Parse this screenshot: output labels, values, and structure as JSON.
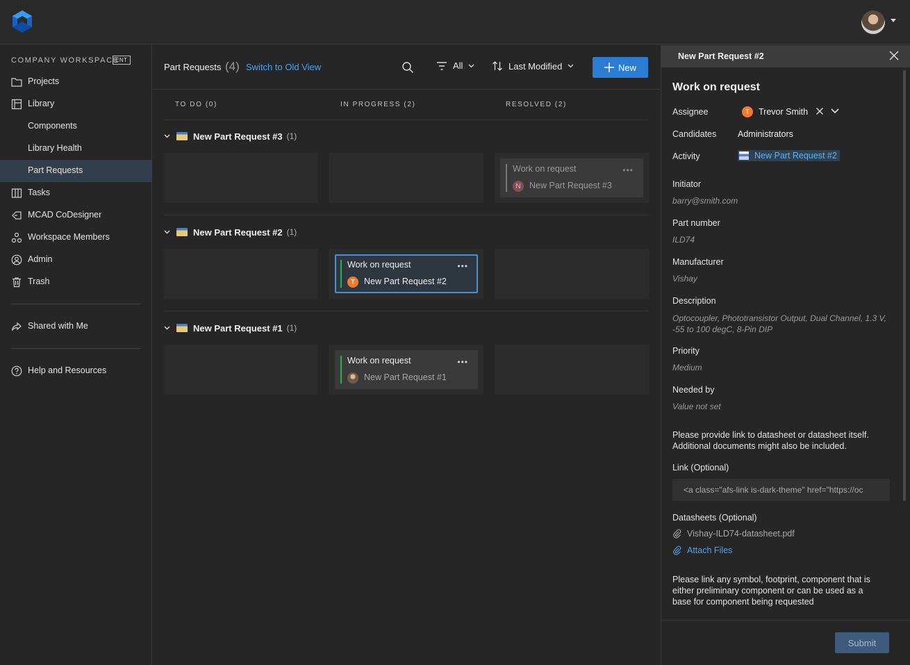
{
  "sidebar": {
    "workspace_label": "COMPANY WORKSPACE",
    "workspace_badge": "ENT",
    "items": [
      {
        "label": "Projects"
      },
      {
        "label": "Library"
      },
      {
        "label": "Components"
      },
      {
        "label": "Library Health"
      },
      {
        "label": "Part Requests"
      },
      {
        "label": "Tasks"
      },
      {
        "label": "MCAD CoDesigner"
      },
      {
        "label": "Workspace Members"
      },
      {
        "label": "Admin"
      },
      {
        "label": "Trash"
      },
      {
        "label": "Shared with Me"
      },
      {
        "label": "Help and Resources"
      }
    ]
  },
  "toolbar": {
    "title": "Part Requests",
    "count": "(4)",
    "switch_link": "Switch to Old View",
    "filter_label": "All",
    "sort_label": "Last Modified",
    "new_label": "New"
  },
  "board": {
    "columns": [
      "TO DO  (0)",
      "IN PROGRESS  (2)",
      "RESOLVED  (2)"
    ],
    "groups": [
      {
        "title": "New Part Request #3",
        "count": "(1)",
        "card": {
          "title": "Work on request",
          "sub": "New Part Request #3",
          "avatar": "N"
        }
      },
      {
        "title": "New Part Request #2",
        "count": "(1)",
        "card": {
          "title": "Work on request",
          "sub": "New Part Request #2",
          "avatar": "T"
        }
      },
      {
        "title": "New Part Request #1",
        "count": "(1)",
        "card": {
          "title": "Work on request",
          "sub": "New Part Request #1",
          "avatar": ""
        }
      }
    ]
  },
  "panel": {
    "header": "New Part Request #2",
    "heading": "Work on request",
    "assignee_label": "Assignee",
    "assignee_initial": "T",
    "assignee": "Trevor Smith",
    "candidates_label": "Candidates",
    "candidates": "Administrators",
    "activity_label": "Activity",
    "activity": "New Part Request #2",
    "initiator_label": "Initiator",
    "initiator": "barry@smith.com",
    "part_number_label": "Part number",
    "part_number": "ILD74",
    "manufacturer_label": "Manufacturer",
    "manufacturer": "Vishay",
    "description_label": "Description",
    "description": "Optocoupler, Phototransistor Output, Dual Channel, 1.3 V, -55 to 100 degC, 8-Pin DIP",
    "priority_label": "Priority",
    "priority": "Medium",
    "needed_label": "Needed by",
    "needed": "Value not set",
    "info_text": "Please provide link to datasheet or datasheet itself. Additional documents might also be included.",
    "link_label": "Link (Optional)",
    "link_value": "<a class=\"afs-link is-dark-theme\" href=\"https://oc",
    "datasheets_label": "Datasheets (Optional)",
    "datasheet_file": "Vishay-ILD74-datasheet.pdf",
    "attach_label": "Attach Files",
    "info_text2": "Please link any symbol, footprint, component that is either preliminary component  or can be used as a base for component being requested",
    "submit_label": "Submit"
  },
  "colors": {
    "accent": "#2b7dd3",
    "link": "#4ba3ee",
    "in_progress_bar": "#2bb24c",
    "assignee_avatar": "#f07a2d"
  }
}
